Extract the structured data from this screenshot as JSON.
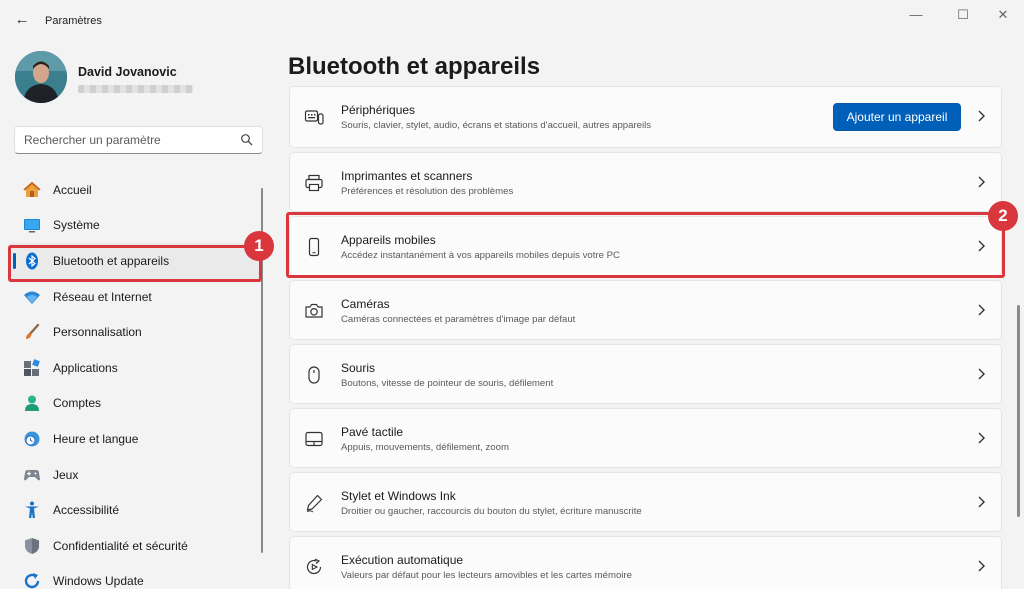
{
  "window": {
    "title": "Paramètres",
    "back_glyph": "←",
    "minimize_glyph": "—",
    "maximize_glyph": "☐",
    "close_glyph": "✕"
  },
  "user": {
    "name": "David Jovanovic"
  },
  "search": {
    "placeholder": "Rechercher un paramètre",
    "value": ""
  },
  "sidebar": {
    "items": [
      {
        "label": "Accueil",
        "icon": "home-icon"
      },
      {
        "label": "Système",
        "icon": "monitor-icon"
      },
      {
        "label": "Bluetooth et appareils",
        "icon": "bluetooth-icon",
        "active": true
      },
      {
        "label": "Réseau et Internet",
        "icon": "wifi-icon"
      },
      {
        "label": "Personnalisation",
        "icon": "brush-icon"
      },
      {
        "label": "Applications",
        "icon": "apps-icon"
      },
      {
        "label": "Comptes",
        "icon": "person-icon"
      },
      {
        "label": "Heure et langue",
        "icon": "clock-globe-icon"
      },
      {
        "label": "Jeux",
        "icon": "gamepad-icon"
      },
      {
        "label": "Accessibilité",
        "icon": "accessibility-icon"
      },
      {
        "label": "Confidentialité et sécurité",
        "icon": "shield-icon"
      },
      {
        "label": "Windows Update",
        "icon": "update-icon"
      }
    ]
  },
  "annotations": {
    "badge1": "1",
    "badge2": "2"
  },
  "main": {
    "title": "Bluetooth et appareils",
    "add_device_label": "Ajouter un appareil",
    "cards": [
      {
        "title": "Périphériques",
        "desc": "Souris, clavier, stylet, audio, écrans et stations d'accueil, autres appareils",
        "icon": "devices-icon"
      },
      {
        "title": "Imprimantes et scanners",
        "desc": "Préférences et résolution des problèmes",
        "icon": "printer-icon"
      },
      {
        "title": "Appareils mobiles",
        "desc": "Accédez instantanément à vos appareils mobiles depuis votre PC",
        "icon": "phone-icon"
      },
      {
        "title": "Caméras",
        "desc": "Caméras connectées et paramètres d'image par défaut",
        "icon": "camera-icon"
      },
      {
        "title": "Souris",
        "desc": "Boutons, vitesse de pointeur de souris, défilement",
        "icon": "mouse-icon"
      },
      {
        "title": "Pavé tactile",
        "desc": "Appuis, mouvements, défilement, zoom",
        "icon": "touchpad-icon"
      },
      {
        "title": "Stylet et Windows Ink",
        "desc": "Droitier ou gaucher, raccourcis du bouton du stylet, écriture manuscrite",
        "icon": "pen-icon"
      },
      {
        "title": "Exécution automatique",
        "desc": "Valeurs par défaut pour les lecteurs amovibles et les cartes mémoire",
        "icon": "autoplay-icon"
      }
    ]
  },
  "colors": {
    "accent": "#005fb8",
    "annotation_red": "#d9363e",
    "background": "#f3f3f3"
  }
}
